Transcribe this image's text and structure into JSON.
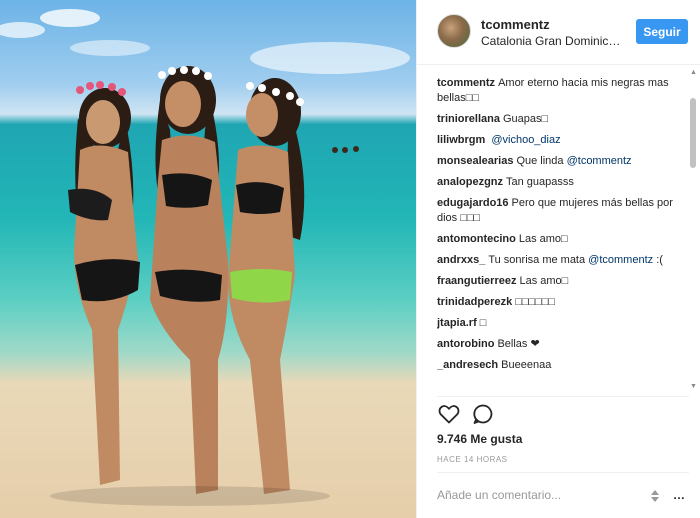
{
  "post": {
    "photo_icon": "beach-photo"
  },
  "header": {
    "username": "tcommentz",
    "location": "Catalonia Gran Dominic…",
    "follow_label": "Seguir"
  },
  "comments": [
    {
      "user": "tcommentz",
      "text": "Amor eterno hacia mis negras mas bellas□□",
      "mention": ""
    },
    {
      "user": "triniorellana",
      "text": "Guapas□",
      "mention": ""
    },
    {
      "user": "liliwbrgm",
      "text": "",
      "mention": "@vichoo_diaz"
    },
    {
      "user": "monsealearias",
      "text": "Que linda",
      "mention": "@tcommentz"
    },
    {
      "user": "analopezgnz",
      "text": "Tan guapasss",
      "mention": ""
    },
    {
      "user": "edugajardo16",
      "text": "Pero que mujeres más bellas por dios □□□",
      "mention": ""
    },
    {
      "user": "antomontecino",
      "text": "Las amo□",
      "mention": ""
    },
    {
      "user": "andrxxs_",
      "text": "Tu sonrisa me mata",
      "mention": "@tcommentz",
      "after": ":("
    },
    {
      "user": "fraangutierreez",
      "text": "Las amo□",
      "mention": ""
    },
    {
      "user": "trinidadperezk",
      "text": "□□□□□□",
      "mention": ""
    },
    {
      "user": "jtapia.rf",
      "text": "□",
      "mention": ""
    },
    {
      "user": "antorobino",
      "text": "Bellas ❤",
      "mention": ""
    },
    {
      "user": "_andresech",
      "text": "Bueeenaa",
      "mention": ""
    }
  ],
  "actions": {
    "like_icon": "heart-icon",
    "comment_icon": "comment-bubble-icon"
  },
  "likes_text": "9.746 Me gusta",
  "timestamp": "HACE 14 HORAS",
  "add_comment_placeholder": "Añade un comentario...",
  "options_glyph": "…",
  "colors": {
    "follow_button": "#3897f0",
    "mention": "#003569",
    "muted": "#999999"
  }
}
